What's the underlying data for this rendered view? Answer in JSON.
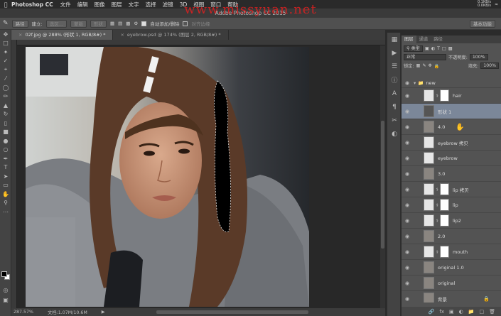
{
  "menubar": {
    "apple": "",
    "app": "Photoshop CC",
    "menus": [
      "文件",
      "编辑",
      "图像",
      "图层",
      "文字",
      "选择",
      "滤镜",
      "3D",
      "视图",
      "窗口",
      "帮助"
    ],
    "net_up": "0.1KB/s",
    "net_down": "0.0KB/s"
  },
  "window": {
    "title": "Adobe Photoshop CC 2015",
    "watermark": "www.missyuan.net"
  },
  "options": {
    "shape_mode": "路径",
    "make_label": "建立:",
    "selection_btn": "选区...",
    "mask_btn": "蒙版",
    "shape_btn": "形状",
    "auto_add_label": "自动添加/删除",
    "align_edges_label": "对齐边缘",
    "workspace": "基本功能"
  },
  "doc_tabs": [
    {
      "label": "02f.jpg @ 288% (形状 1, RGB/8#) *",
      "active": true
    },
    {
      "label": "eyebrow.psd @ 174% (图层 2, RGB/8#) *",
      "active": false
    }
  ],
  "status": {
    "zoom": "287.57%",
    "doc_info": "文档:1.07M/10.6M"
  },
  "panel": {
    "tabs": [
      "图层",
      "通道",
      "路径"
    ],
    "filter_kind": "类型",
    "blend_mode": "正常",
    "opacity_label": "不透明度:",
    "opacity_value": "100%",
    "lock_label": "锁定:",
    "fill_label": "填充:",
    "fill_value": "100%",
    "layers": [
      {
        "name": "new",
        "kind": "group"
      },
      {
        "name": "hair",
        "kind": "masked",
        "thumb": "white"
      },
      {
        "name": "形状 1",
        "kind": "shape",
        "selected": true
      },
      {
        "name": "4.0",
        "kind": "photo"
      },
      {
        "name": "eyebrow 拷贝",
        "kind": "plain",
        "thumb": "white"
      },
      {
        "name": "eyebrow",
        "kind": "plain",
        "thumb": "white"
      },
      {
        "name": "3.0",
        "kind": "photo"
      },
      {
        "name": "lip 拷贝",
        "kind": "masked",
        "thumb": "white"
      },
      {
        "name": "lip",
        "kind": "masked",
        "thumb": "white"
      },
      {
        "name": "lip2",
        "kind": "masked",
        "thumb": "white"
      },
      {
        "name": "2.0",
        "kind": "photo"
      },
      {
        "name": "mouth",
        "kind": "masked",
        "thumb": "white"
      },
      {
        "name": "original 1.0",
        "kind": "photo"
      },
      {
        "name": "original",
        "kind": "photo"
      },
      {
        "name": "背景",
        "kind": "background"
      }
    ]
  },
  "colors": {
    "selected_layer": "#7b8799",
    "watermark": "#e02020"
  }
}
